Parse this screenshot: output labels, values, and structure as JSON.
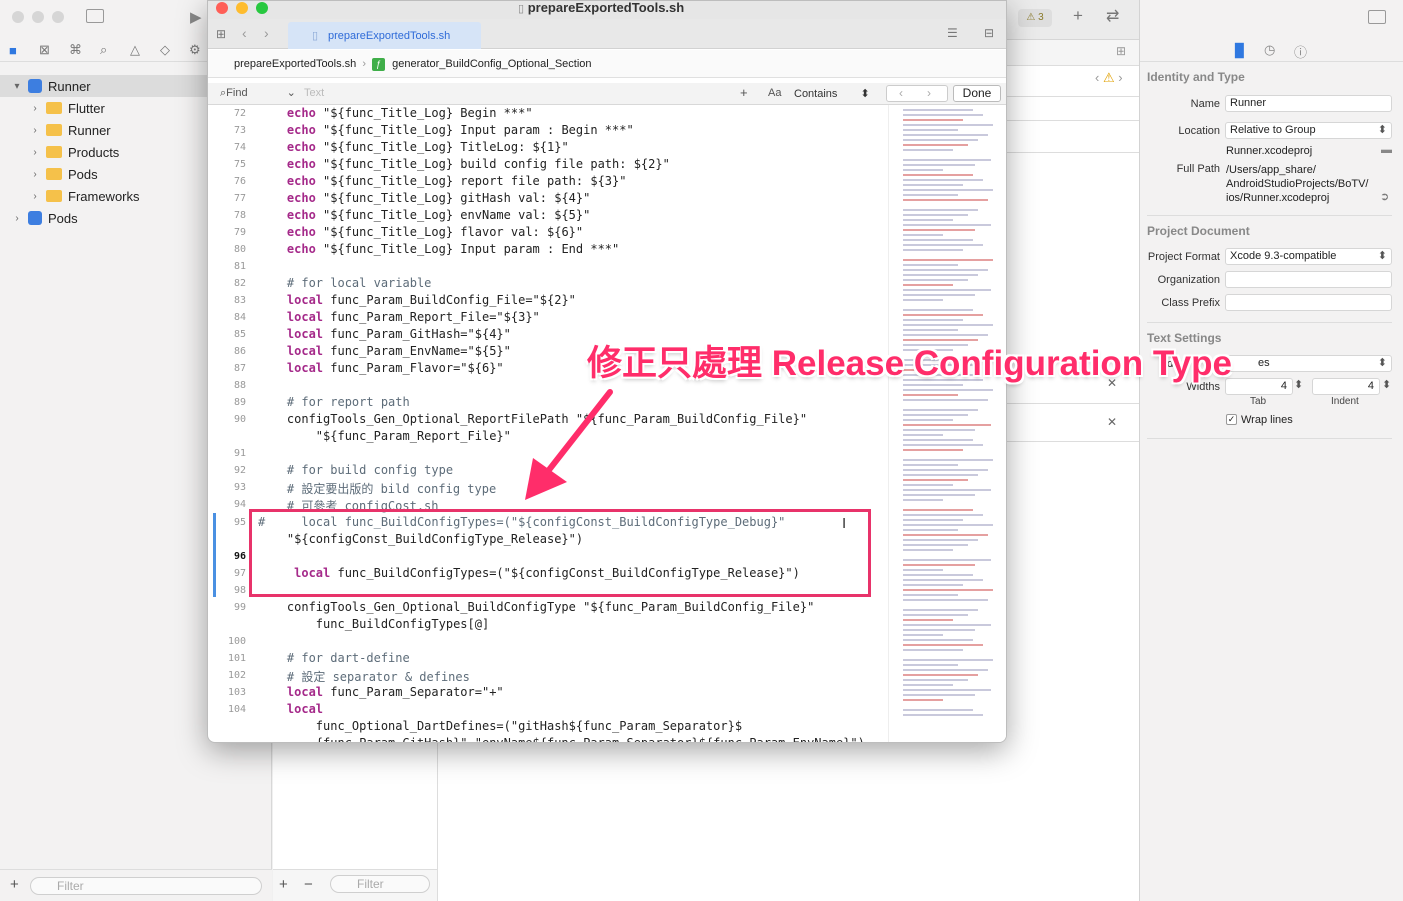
{
  "window": {
    "title": "prepareExportedTools.sh",
    "tab_label": "prepareExportedTools.sh"
  },
  "jumpbar": {
    "file": "prepareExportedTools.sh",
    "symbol": "generator_BuildConfig_Optional_Section"
  },
  "find": {
    "mode": "Find",
    "placeholder": "Text",
    "case_label": "Aa",
    "match": "Contains",
    "done": "Done"
  },
  "navigator": {
    "items": [
      {
        "label": "Runner",
        "level": 0,
        "kind": "project",
        "expanded": true,
        "selected": true
      },
      {
        "label": "Flutter",
        "level": 1,
        "kind": "folder"
      },
      {
        "label": "Runner",
        "level": 1,
        "kind": "folder"
      },
      {
        "label": "Products",
        "level": 1,
        "kind": "folder"
      },
      {
        "label": "Pods",
        "level": 1,
        "kind": "folder"
      },
      {
        "label": "Frameworks",
        "level": 1,
        "kind": "folder"
      },
      {
        "label": "Pods",
        "level": 0,
        "kind": "project"
      }
    ],
    "filter_placeholder": "Filter"
  },
  "middle": {
    "warning_count": "3",
    "filter_placeholder": "Filter"
  },
  "inspector": {
    "identity_title": "Identity and Type",
    "name_label": "Name",
    "name_value": "Runner",
    "location_label": "Location",
    "location_value": "Relative to Group",
    "file_name": "Runner.xcodeproj",
    "fullpath_label": "Full Path",
    "fullpath_lines": [
      "/Users/app_share/",
      "AndroidStudioProjects/BoTV/",
      "ios/Runner.xcodeproj"
    ],
    "project_doc_title": "Project Document",
    "format_label": "Project Format",
    "format_value": "Xcode 9.3-compatible",
    "org_label": "Organization",
    "prefix_label": "Class Prefix",
    "text_title": "Text Settings",
    "indent_label": "nde",
    "indent_value": "es",
    "widths_label": "Widths",
    "tab_value": "4",
    "indent_width_value": "4",
    "tab_caption": "Tab",
    "indent_caption": "Indent",
    "wrap_label": "Wrap lines"
  },
  "annotation": "修正只處理 Release Configuration Type",
  "code_lines": [
    {
      "n": "72",
      "t": "    echo \"${func_Title_Log} Begin ***\""
    },
    {
      "n": "73",
      "t": "    echo \"${func_Title_Log} Input param : Begin ***\""
    },
    {
      "n": "74",
      "t": "    echo \"${func_Title_Log} TitleLog: ${1}\""
    },
    {
      "n": "75",
      "t": "    echo \"${func_Title_Log} build config file path: ${2}\""
    },
    {
      "n": "76",
      "t": "    echo \"${func_Title_Log} report file path: ${3}\""
    },
    {
      "n": "77",
      "t": "    echo \"${func_Title_Log} gitHash val: ${4}\""
    },
    {
      "n": "78",
      "t": "    echo \"${func_Title_Log} envName val: ${5}\""
    },
    {
      "n": "79",
      "t": "    echo \"${func_Title_Log} flavor val: ${6}\""
    },
    {
      "n": "80",
      "t": "    echo \"${func_Title_Log} Input param : End ***\""
    },
    {
      "n": "81",
      "t": ""
    },
    {
      "n": "82",
      "t": "    # for local variable"
    },
    {
      "n": "83",
      "t": "    local func_Param_BuildConfig_File=\"${2}\""
    },
    {
      "n": "84",
      "t": "    local func_Param_Report_File=\"${3}\""
    },
    {
      "n": "85",
      "t": "    local func_Param_GitHash=\"${4}\""
    },
    {
      "n": "86",
      "t": "    local func_Param_EnvName=\"${5}\""
    },
    {
      "n": "87",
      "t": "    local func_Param_Flavor=\"${6}\""
    },
    {
      "n": "88",
      "t": ""
    },
    {
      "n": "89",
      "t": "    # for report path"
    },
    {
      "n": "90",
      "t": "    configTools_Gen_Optional_ReportFilePath \"${func_Param_BuildConfig_File}\""
    },
    {
      "n": "",
      "t": "        \"${func_Param_Report_File}\""
    },
    {
      "n": "91",
      "t": ""
    },
    {
      "n": "92",
      "t": "    # for build config type"
    },
    {
      "n": "93",
      "t": "    # 設定要出版的 bild config type"
    },
    {
      "n": "94",
      "t": "    # 可參考 configCost.sh"
    },
    {
      "n": "95",
      "t": "#     local func_BuildConfigTypes=(\"${configConst_BuildConfigType_Debug}\""
    },
    {
      "n": "",
      "t": "    \"${configConst_BuildConfigType_Release}\")"
    },
    {
      "n": "96",
      "t": ""
    },
    {
      "n": "97",
      "t": "     local func_BuildConfigTypes=(\"${configConst_BuildConfigType_Release}\")"
    },
    {
      "n": "98",
      "t": ""
    },
    {
      "n": "99",
      "t": "    configTools_Gen_Optional_BuildConfigType \"${func_Param_BuildConfig_File}\""
    },
    {
      "n": "",
      "t": "        func_BuildConfigTypes[@]"
    },
    {
      "n": "100",
      "t": ""
    },
    {
      "n": "101",
      "t": "    # for dart-define"
    },
    {
      "n": "102",
      "t": "    # 設定 separator & defines"
    },
    {
      "n": "103",
      "t": "    local func_Param_Separator=\"+\""
    },
    {
      "n": "104",
      "t": "    local"
    },
    {
      "n": "",
      "t": "        func_Optional_DartDefines=(\"gitHash${func_Param_Separator}$"
    },
    {
      "n": "",
      "t": "        {func_Param_GitHash}\" \"envName${func_Param_Separator}${func_Param_EnvName}\")"
    }
  ]
}
